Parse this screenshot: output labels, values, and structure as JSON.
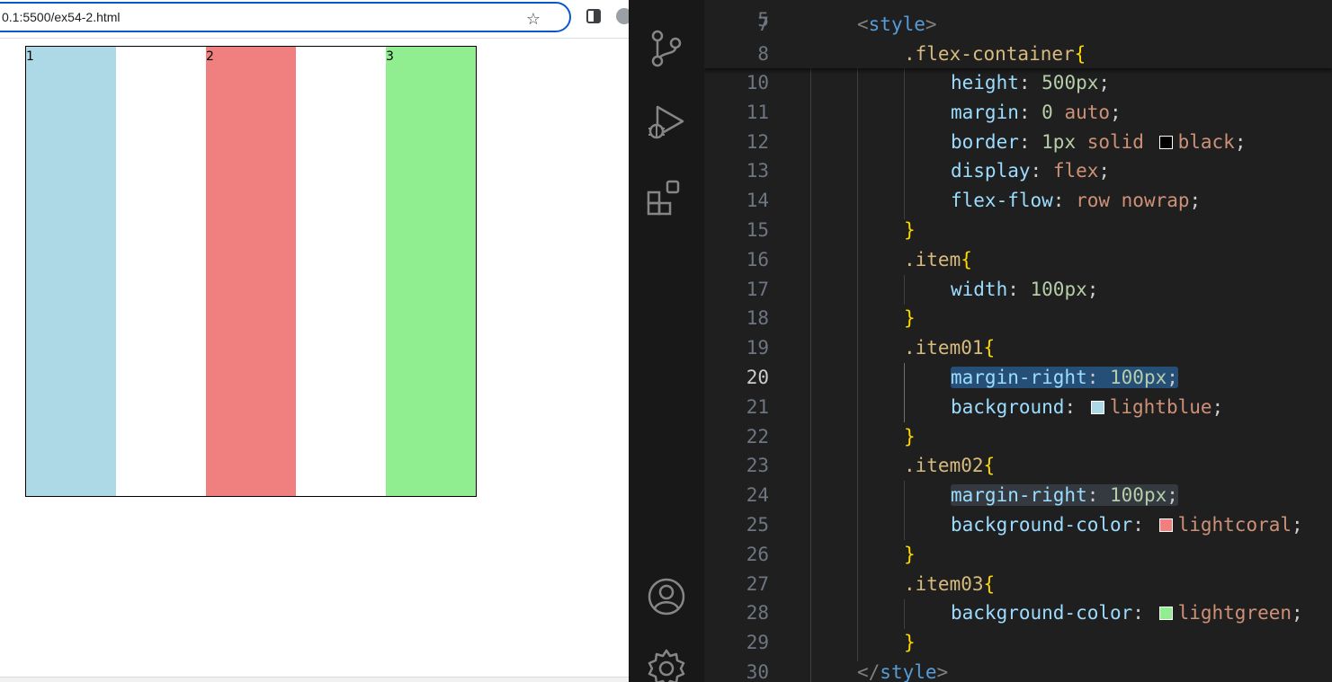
{
  "browser": {
    "url": "0.1:5500/ex54-2.html",
    "items": [
      {
        "label": "1",
        "color": "#add8e6"
      },
      {
        "label": "2",
        "color": "#f08080"
      },
      {
        "label": "3",
        "color": "#90ee90"
      }
    ]
  },
  "activity_bar": {
    "icons": [
      "source-control-icon",
      "run-debug-icon",
      "extensions-icon",
      "accounts-icon",
      "manage-gear-icon"
    ]
  },
  "editor": {
    "active_line": "20",
    "sticky_lines": [
      {
        "num": "7",
        "tokens": [
          {
            "t": "<",
            "c": "t-lt"
          },
          {
            "t": "style",
            "c": "t-tag"
          },
          {
            "t": ">",
            "c": "t-lt"
          }
        ]
      },
      {
        "num": "8",
        "tokens": [
          {
            "t": ".flex-container",
            "c": "t-sel"
          },
          {
            "t": "{",
            "c": "t-brace"
          }
        ]
      }
    ],
    "lines": [
      {
        "num": "10",
        "tokens": [
          {
            "t": "height",
            "c": "t-prop"
          },
          {
            "t": ": ",
            "c": "t-punc"
          },
          {
            "t": "500px",
            "c": "t-num"
          },
          {
            "t": ";",
            "c": "t-punc"
          }
        ]
      },
      {
        "num": "11",
        "tokens": [
          {
            "t": "margin",
            "c": "t-prop"
          },
          {
            "t": ": ",
            "c": "t-punc"
          },
          {
            "t": "0",
            "c": "t-num"
          },
          {
            "t": " auto",
            "c": "t-val"
          },
          {
            "t": ";",
            "c": "t-punc"
          }
        ]
      },
      {
        "num": "12",
        "tokens": [
          {
            "t": "border",
            "c": "t-prop"
          },
          {
            "t": ": ",
            "c": "t-punc"
          },
          {
            "t": "1px",
            "c": "t-num"
          },
          {
            "t": " solid ",
            "c": "t-val"
          },
          {
            "swatch": "#000000"
          },
          {
            "t": "black",
            "c": "t-val"
          },
          {
            "t": ";",
            "c": "t-punc"
          }
        ]
      },
      {
        "num": "13",
        "tokens": [
          {
            "t": "display",
            "c": "t-prop"
          },
          {
            "t": ": ",
            "c": "t-punc"
          },
          {
            "t": "flex",
            "c": "t-val"
          },
          {
            "t": ";",
            "c": "t-punc"
          }
        ]
      },
      {
        "num": "14",
        "tokens": [
          {
            "t": "flex-flow",
            "c": "t-prop"
          },
          {
            "t": ": ",
            "c": "t-punc"
          },
          {
            "t": "row nowrap",
            "c": "t-val"
          },
          {
            "t": ";",
            "c": "t-punc"
          }
        ]
      },
      {
        "num": "15",
        "tokens": [
          {
            "t": "}",
            "c": "t-brace"
          }
        ]
      },
      {
        "num": "16",
        "tokens": [
          {
            "t": ".item",
            "c": "t-sel"
          },
          {
            "t": "{",
            "c": "t-brace"
          }
        ]
      },
      {
        "num": "17",
        "tokens": [
          {
            "t": "width",
            "c": "t-prop"
          },
          {
            "t": ": ",
            "c": "t-punc"
          },
          {
            "t": "100px",
            "c": "t-num"
          },
          {
            "t": ";",
            "c": "t-punc"
          }
        ]
      },
      {
        "num": "18",
        "tokens": [
          {
            "t": "}",
            "c": "t-brace"
          }
        ]
      },
      {
        "num": "19",
        "tokens": [
          {
            "t": ".item01",
            "c": "t-sel"
          },
          {
            "t": "{",
            "c": "t-brace"
          }
        ]
      },
      {
        "num": "20",
        "highlight": "active",
        "tokens": [
          {
            "t": "margin-right",
            "c": "t-prop"
          },
          {
            "t": ": ",
            "c": "t-punc"
          },
          {
            "t": "100px",
            "c": "t-num"
          },
          {
            "t": ";",
            "c": "t-punc"
          }
        ]
      },
      {
        "num": "21",
        "tokens": [
          {
            "t": "background",
            "c": "t-prop"
          },
          {
            "t": ": ",
            "c": "t-punc"
          },
          {
            "swatch": "#add8e6"
          },
          {
            "t": "lightblue",
            "c": "t-val"
          },
          {
            "t": ";",
            "c": "t-punc"
          }
        ]
      },
      {
        "num": "22",
        "tokens": [
          {
            "t": "}",
            "c": "t-brace"
          }
        ]
      },
      {
        "num": "23",
        "tokens": [
          {
            "t": ".item02",
            "c": "t-sel"
          },
          {
            "t": "{",
            "c": "t-brace"
          }
        ]
      },
      {
        "num": "24",
        "highlight": "other",
        "tokens": [
          {
            "t": "margin-right",
            "c": "t-prop"
          },
          {
            "t": ": ",
            "c": "t-punc"
          },
          {
            "t": "100px",
            "c": "t-num"
          },
          {
            "t": ";",
            "c": "t-punc"
          }
        ]
      },
      {
        "num": "25",
        "tokens": [
          {
            "t": "background-color",
            "c": "t-prop"
          },
          {
            "t": ": ",
            "c": "t-punc"
          },
          {
            "swatch": "#f08080"
          },
          {
            "t": "lightcoral",
            "c": "t-val"
          },
          {
            "t": ";",
            "c": "t-punc"
          }
        ]
      },
      {
        "num": "26",
        "tokens": [
          {
            "t": "}",
            "c": "t-brace"
          }
        ]
      },
      {
        "num": "27",
        "tokens": [
          {
            "t": ".item03",
            "c": "t-sel"
          },
          {
            "t": "{",
            "c": "t-brace"
          }
        ]
      },
      {
        "num": "28",
        "tokens": [
          {
            "t": "background-color",
            "c": "t-prop"
          },
          {
            "t": ": ",
            "c": "t-punc"
          },
          {
            "swatch": "#90ee90"
          },
          {
            "t": "lightgreen",
            "c": "t-val"
          },
          {
            "t": ";",
            "c": "t-punc"
          }
        ]
      },
      {
        "num": "29",
        "tokens": [
          {
            "t": "}",
            "c": "t-brace"
          }
        ]
      },
      {
        "num": "30",
        "tokens": [
          {
            "t": "</",
            "c": "t-lt"
          },
          {
            "t": "style",
            "c": "t-tag"
          },
          {
            "t": ">",
            "c": "t-lt"
          }
        ]
      }
    ]
  }
}
